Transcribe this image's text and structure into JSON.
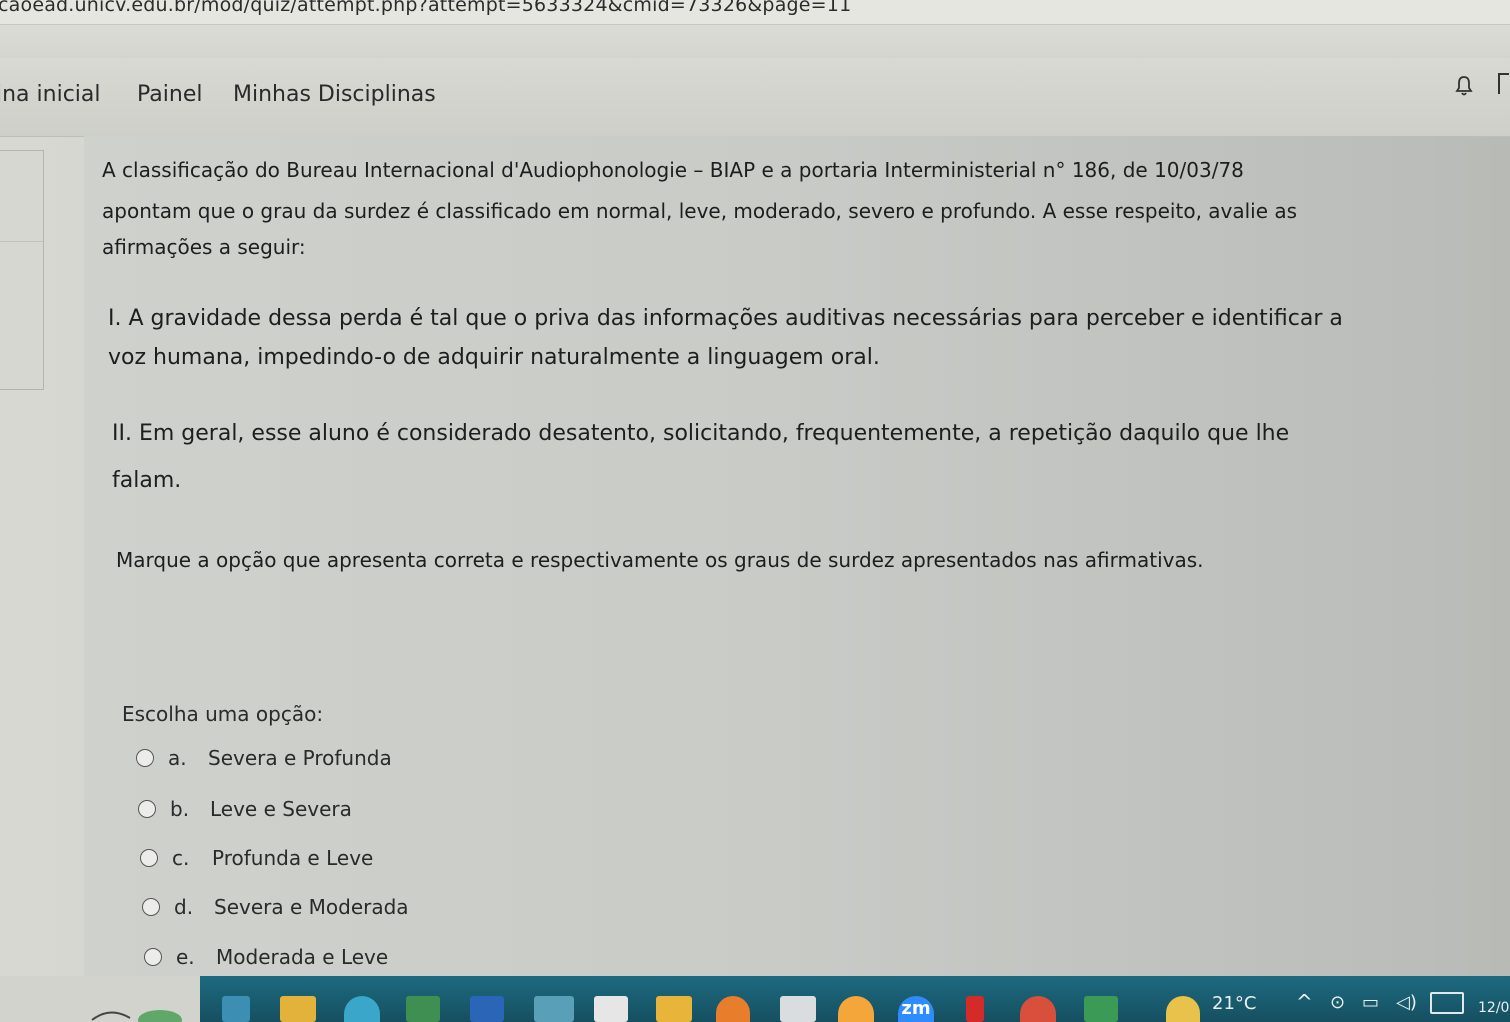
{
  "browser": {
    "url": "caoead.unicv.edu.br/mod/quiz/attempt.php?attempt=5633324&cmid=73326&page=11"
  },
  "nav": {
    "home": "ina inicial",
    "painel": "Painel",
    "disciplinas": "Minhas Disciplinas"
  },
  "question": {
    "intro_line1": "A classificação do Bureau Internacional d'Audiophonologie – BIAP e a portaria Interministerial n° 186, de 10/03/78",
    "intro_line2": "apontam que o grau da surdez é  classificado em normal, leve, moderado, severo e profundo. A esse respeito, avalie as",
    "intro_line3": "afirmações a seguir:",
    "stmt1_line1": "I. A gravidade dessa perda é tal que o priva das informações auditivas necessárias para perceber e identificar a",
    "stmt1_line2": "voz humana, impedindo-o de adquirir naturalmente a linguagem oral.",
    "stmt2_line1": "II. Em geral, esse aluno é considerado desatento, solicitando, frequentemente, a repetição daquilo que lhe",
    "stmt2_line2": "falam.",
    "prompt": "Marque a opção que apresenta correta e respectivamente os graus de surdez apresentados nas afirmativas.",
    "choose_label": "Escolha uma opção:",
    "options": [
      {
        "letter": "a.",
        "text": "Severa e Profunda"
      },
      {
        "letter": "b.",
        "text": "Leve e Severa"
      },
      {
        "letter": "c.",
        "text": "Profunda e Leve"
      },
      {
        "letter": "d.",
        "text": "Severa e Moderada"
      },
      {
        "letter": "e.",
        "text": "Moderada e Leve"
      }
    ]
  },
  "taskbar": {
    "weather": "21°C",
    "zoom_icon_label": "zm",
    "clock_partial": "12/0"
  },
  "icons": {
    "notifications": "bell-icon",
    "messages": "chat-icon"
  },
  "colors": {
    "taskbar": "#1d6a80",
    "page_background": "#cfd0cb"
  }
}
